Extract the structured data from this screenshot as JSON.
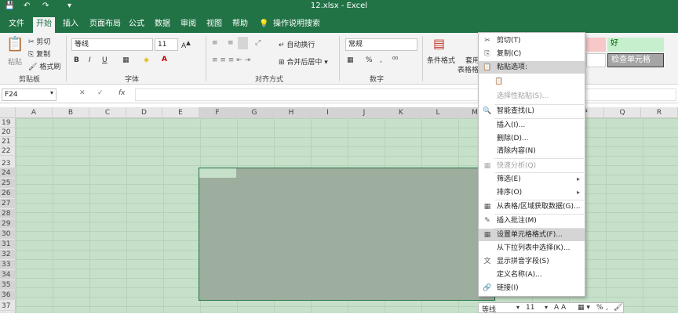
{
  "title": "12.xlsx - Excel",
  "tabs": [
    {
      "label": "文件"
    },
    {
      "label": "开始"
    },
    {
      "label": "插入"
    },
    {
      "label": "页面布局"
    },
    {
      "label": "公式"
    },
    {
      "label": "数据"
    },
    {
      "label": "审阅"
    },
    {
      "label": "视图"
    },
    {
      "label": "帮助"
    },
    {
      "label": "操作说明搜索"
    }
  ],
  "ribbon": {
    "clipboard": {
      "paste": "粘贴",
      "cut": "剪切",
      "copy": "复制",
      "format_painter": "格式刷",
      "label": "剪贴板"
    },
    "font": {
      "name": "等线",
      "size": "11",
      "label": "字体",
      "bold": "B",
      "italic": "I",
      "underline": "U"
    },
    "alignment": {
      "wrap": "自动换行",
      "merge": "合并后居中",
      "label": "对齐方式"
    },
    "number": {
      "format": "常规",
      "label": "数字",
      "percent": "%",
      "comma": ","
    },
    "styles": {
      "conditional": "条件格式",
      "table": "套用",
      "table2": "表格格式",
      "good": "好",
      "check": "检查单元格"
    }
  },
  "formula": {
    "namebox": "F24",
    "fx": "fx",
    "cancel": "✕",
    "enter": "✓"
  },
  "columns": [
    "A",
    "B",
    "C",
    "D",
    "E",
    "F",
    "G",
    "H",
    "I",
    "J",
    "K",
    "L",
    "M",
    "N",
    "O",
    "P",
    "Q",
    "R"
  ],
  "rows": [
    "19",
    "20",
    "21",
    "22",
    "23",
    "24",
    "25",
    "26",
    "27",
    "28",
    "29",
    "30",
    "31",
    "32",
    "33",
    "34",
    "35",
    "36",
    "37"
  ],
  "context_menu": [
    {
      "label": "剪切(T)",
      "icon": "✂",
      "disabled": false
    },
    {
      "label": "复制(C)",
      "icon": "⎘",
      "disabled": false
    },
    {
      "label": "粘贴选项:",
      "icon": "📋",
      "disabled": false
    },
    {
      "label": "",
      "icon": "📋",
      "disabled": true
    },
    {
      "label": "选择性粘贴(S)...",
      "icon": "",
      "disabled": true
    },
    {
      "label": "智能查找(L)",
      "icon": "🔍",
      "disabled": false
    },
    {
      "label": "插入(I)...",
      "icon": "",
      "disabled": false
    },
    {
      "label": "删除(D)...",
      "icon": "",
      "disabled": false
    },
    {
      "label": "清除内容(N)",
      "icon": "",
      "disabled": false
    },
    {
      "label": "快速分析(Q)",
      "icon": "▦",
      "disabled": true
    },
    {
      "label": "筛选(E)",
      "icon": "",
      "disabled": false,
      "submenu": true
    },
    {
      "label": "排序(O)",
      "icon": "",
      "disabled": false,
      "submenu": true
    },
    {
      "label": "从表格/区域获取数据(G)...",
      "icon": "▦",
      "disabled": false
    },
    {
      "label": "插入批注(M)",
      "icon": "✎",
      "disabled": false
    },
    {
      "label": "设置单元格格式(F)...",
      "icon": "▦",
      "disabled": false,
      "highlighted": true
    },
    {
      "label": "从下拉列表中选择(K)...",
      "icon": "",
      "disabled": false
    },
    {
      "label": "显示拼音字段(S)",
      "icon": "文",
      "disabled": false
    },
    {
      "label": "定义名称(A)...",
      "icon": "",
      "disabled": false
    },
    {
      "label": "链接(I)",
      "icon": "🔗",
      "disabled": false
    }
  ],
  "minibar": {
    "font": "等线",
    "size": "11",
    "percent": "%",
    "comma": ","
  },
  "colors": {
    "excel_green": "#217346",
    "sheet_tint": "#c6e0c9",
    "selection": "#9dae9f",
    "good_fill": "#c6efce",
    "check_fill": "#a5a5a5"
  }
}
